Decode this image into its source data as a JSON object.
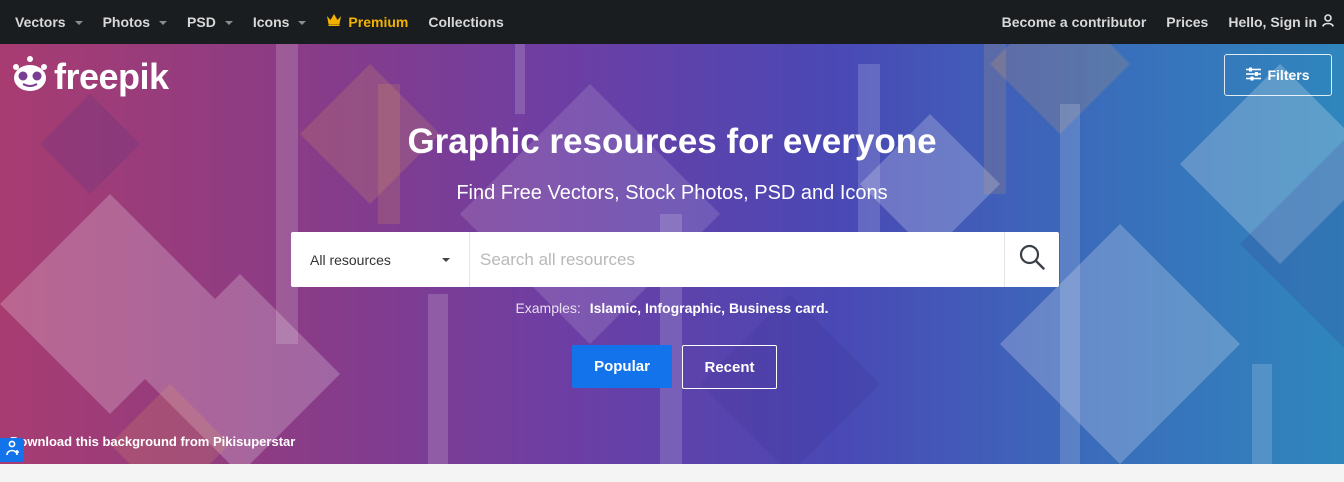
{
  "nav": {
    "vectors": "Vectors",
    "photos": "Photos",
    "psd": "PSD",
    "icons": "Icons",
    "premium": "Premium",
    "collections": "Collections",
    "contributor": "Become a contributor",
    "prices": "Prices",
    "signin": "Hello, Sign in"
  },
  "logo": {
    "text": "freepik"
  },
  "filters": {
    "label": "Filters"
  },
  "hero": {
    "title": "Graphic resources for everyone",
    "subtitle": "Find Free Vectors, Stock Photos, PSD and Icons"
  },
  "search": {
    "category": "All resources",
    "placeholder": "Search all resources",
    "value": ""
  },
  "examples": {
    "label": "Examples:",
    "links": "Islamic, Infographic, Business card."
  },
  "tabs": {
    "popular": "Popular",
    "recent": "Recent"
  },
  "credit": "Download this background from Pikisuperstar",
  "icons": {
    "crown": "crown-icon",
    "user": "user-icon",
    "filters": "sliders-icon",
    "search": "search-icon",
    "accessibility": "accessibility-icon"
  },
  "colors": {
    "nav_bg": "#1a1d1f",
    "premium": "#f2b300",
    "accent": "#1273eb"
  }
}
